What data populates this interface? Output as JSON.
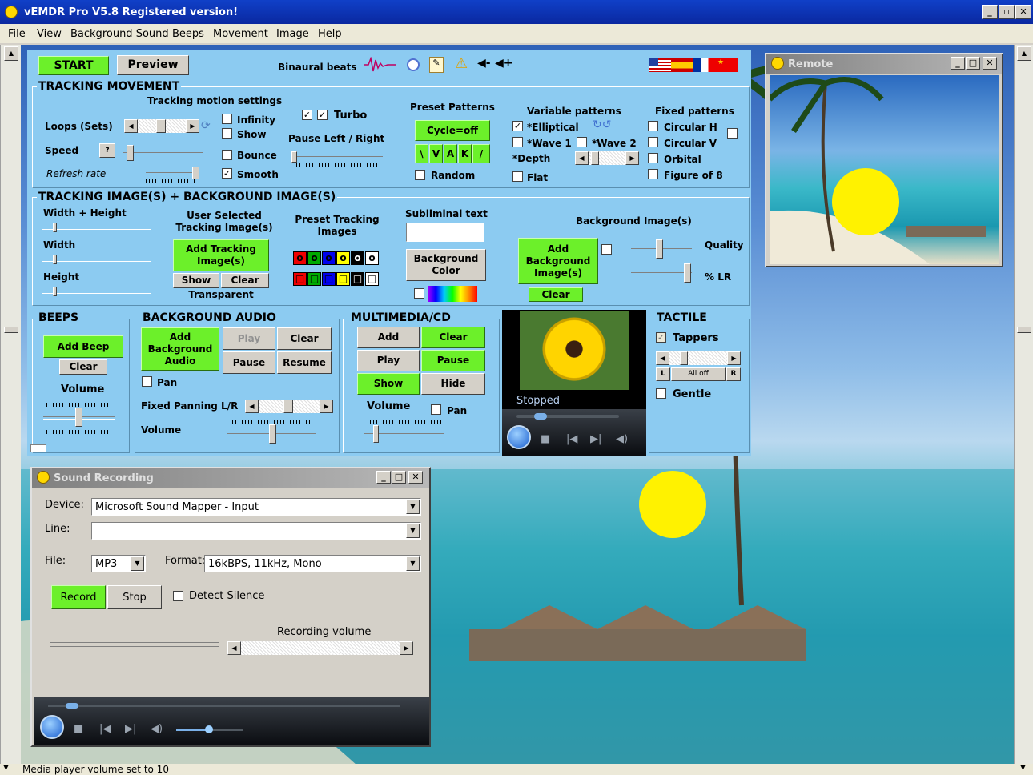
{
  "app": {
    "title": "vEMDR Pro V5.8 Registered version!"
  },
  "menu": [
    "File",
    "View",
    "Background Sound",
    "Beeps",
    "Movement",
    "Image",
    "Help"
  ],
  "toolbar": {
    "start": "START",
    "preview": "Preview",
    "binaural": "Binaural beats"
  },
  "tracking": {
    "header": "TRACKING MOVEMENT",
    "motion_settings": "Tracking motion settings",
    "loops": "Loops (Sets)",
    "speed": "Speed",
    "refresh": "Refresh rate",
    "infinity": "Infinity",
    "show": "Show",
    "bounce": "Bounce",
    "smooth": "Smooth",
    "turbo": "Turbo",
    "pause_lr": "Pause Left / Right",
    "speed_btn": "?"
  },
  "preset": {
    "header": "Preset Patterns",
    "cycle": "Cycle=off",
    "buttons": [
      "\\",
      "V",
      "A",
      "K",
      "/"
    ],
    "random": "Random"
  },
  "variable": {
    "header": "Variable patterns",
    "elliptical": "*Elliptical",
    "wave1": "*Wave 1",
    "wave2": "*Wave 2",
    "depth": "*Depth",
    "flat": "Flat"
  },
  "fixed": {
    "header": "Fixed patterns",
    "circular_h": "Circular H",
    "circular_v": "Circular V",
    "orbital": "Orbital",
    "figure8": "Figure of 8"
  },
  "images": {
    "header": "TRACKING IMAGE(S) + BACKGROUND IMAGE(S)",
    "wh": "Width + Height",
    "width": "Width",
    "height": "Height",
    "user_selected": "User Selected Tracking Image(s)",
    "add_tracking": "Add Tracking Image(s)",
    "show": "Show",
    "clear": "Clear",
    "transparent": "Transparent",
    "preset_tracking": "Preset Tracking Images",
    "subliminal": "Subliminal text",
    "bg_color": "Background Color",
    "bg_images": "Background Image(s)",
    "add_bg": "Add Background Image(s)",
    "clear_bg": "Clear",
    "quality": "Quality",
    "lr": "% LR",
    "preset_glyph": "o"
  },
  "beeps": {
    "header": "BEEPS",
    "add": "Add Beep",
    "clear": "Clear",
    "volume": "Volume"
  },
  "bgaudio": {
    "header": "BACKGROUND AUDIO",
    "add": "Add Background Audio",
    "play": "Play",
    "clear": "Clear",
    "pause": "Pause",
    "resume": "Resume",
    "pan": "Pan",
    "fixed_pan": "Fixed Panning L/R",
    "volume": "Volume"
  },
  "multimedia": {
    "header": "MULTIMEDIA/CD",
    "add": "Add",
    "clear": "Clear",
    "play": "Play",
    "pause": "Pause",
    "show": "Show",
    "hide": "Hide",
    "volume": "Volume",
    "pan": "Pan"
  },
  "player": {
    "status": "Stopped"
  },
  "tactile": {
    "header": "TACTILE",
    "tappers": "Tappers",
    "l": "L",
    "all_off": "All off",
    "r": "R",
    "gentle": "Gentle"
  },
  "remote": {
    "title": "Remote"
  },
  "recording": {
    "title": "Sound Recording",
    "device_label": "Device:",
    "device": "Microsoft Sound Mapper - Input",
    "line_label": "Line:",
    "line": "",
    "file_label": "File:",
    "file": "MP3",
    "format_label": "Format:",
    "format": "16kBPS, 11kHz, Mono",
    "record": "Record",
    "stop": "Stop",
    "detect": "Detect Silence",
    "rec_volume": "Recording volume"
  },
  "status": "Media player volume set to 10",
  "colors": {
    "panel": "#8ccbf1",
    "green": "#6cf02a",
    "sun": "#fff200"
  }
}
